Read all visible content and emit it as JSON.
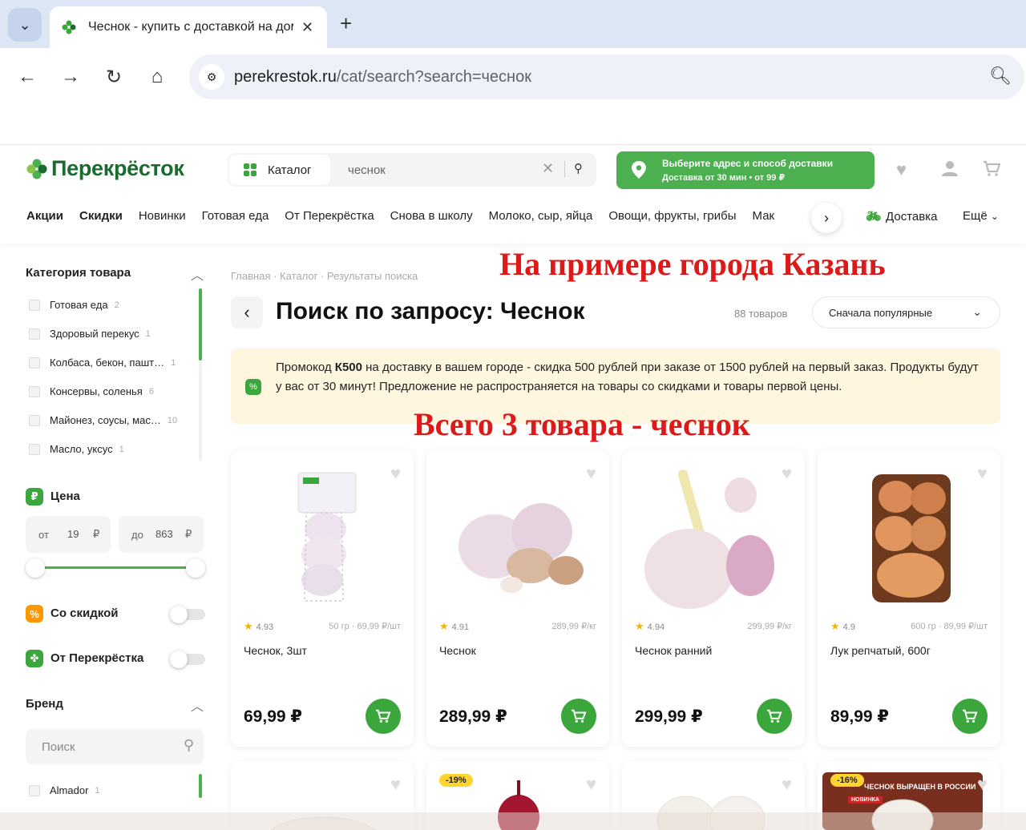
{
  "browser": {
    "tab_title": "Чеснок - купить с доставкой на дом",
    "url_host": "perekrestok.ru",
    "url_path": "/cat/search?search=чеснок"
  },
  "header": {
    "logo": "Перекрёсток",
    "catalog_label": "Каталог",
    "search_value": "чеснок",
    "delivery_title": "Выберите адрес и способ доставки",
    "delivery_sub": "Доставка от 30 мин • от 99 ₽"
  },
  "menu": {
    "items": [
      "Акции",
      "Скидки",
      "Новинки",
      "Готовая еда",
      "От Перекрёстка",
      "Снова в школу",
      "Молоко, сыр, яйца",
      "Овощи, фрукты, грибы",
      "Мак"
    ],
    "delivery": "Доставка",
    "more": "Ещё"
  },
  "sidebar": {
    "category_title": "Категория товара",
    "categories": [
      {
        "name": "Готовая еда",
        "count": "2"
      },
      {
        "name": "Здоровый перекус",
        "count": "1"
      },
      {
        "name": "Колбаса, бекон, пашт…",
        "count": "1"
      },
      {
        "name": "Консервы, соленья",
        "count": "6"
      },
      {
        "name": "Майонез, соусы, мас…",
        "count": "10"
      },
      {
        "name": "Масло, уксус",
        "count": "1"
      }
    ],
    "price_title": "Цена",
    "price_from_label": "от",
    "price_from": "19",
    "price_to_label": "до",
    "price_to": "863",
    "currency": "₽",
    "discount_label": "Со скидкой",
    "own_brand_label": "От Перекрёстка",
    "brand_title": "Бренд",
    "brand_search_placeholder": "Поиск",
    "brands": [
      {
        "name": "Almador",
        "count": "1"
      }
    ]
  },
  "main": {
    "breadcrumbs": [
      "Главная",
      "Каталог",
      "Результаты поиска"
    ],
    "title": "Поиск по запросу:  Чеснок",
    "count": "88 товаров",
    "sort": "Сначала популярные",
    "promo_pre": "Промокод ",
    "promo_code": "К500",
    "promo_text": " на доставку в вашем городе - скидка 500 рублей при заказе от 1500 рублей на первый заказ. Продукты будут у вас от 30 минут! Предложение не распространяется на товары со скидками и товары первой цены.",
    "overlay_top": "На примере города Казань",
    "overlay_mid": "Всего 3 товара - чеснок"
  },
  "products": [
    {
      "name": "Чеснок, 3шт",
      "rating": "4.93",
      "unit": "50 гр · 69,99 ₽/шт",
      "price": "69,99 ₽"
    },
    {
      "name": "Чеснок",
      "rating": "4.91",
      "unit": "289,99 ₽/кг",
      "price": "289,99 ₽"
    },
    {
      "name": "Чеснок ранний",
      "rating": "4.94",
      "unit": "299,99 ₽/кг",
      "price": "299,99 ₽"
    },
    {
      "name": "Лук репчатый, 600г",
      "rating": "4.9",
      "unit": "600 гр · 89,99 ₽/шт",
      "price": "89,99 ₽"
    }
  ],
  "products_row2": [
    {
      "discount": ""
    },
    {
      "discount": "-19%"
    },
    {
      "discount": ""
    },
    {
      "discount": "-16%",
      "banner": "ЧЕСНОК ВЫРАЩЕН В РОССИИ",
      "badge": "НОВИНКА"
    }
  ],
  "colors": {
    "brand_green": "#3ba63b",
    "logo_green": "#1a6b2e",
    "overlay_red": "#dd1a1a",
    "promo_bg": "#fff6e0"
  }
}
